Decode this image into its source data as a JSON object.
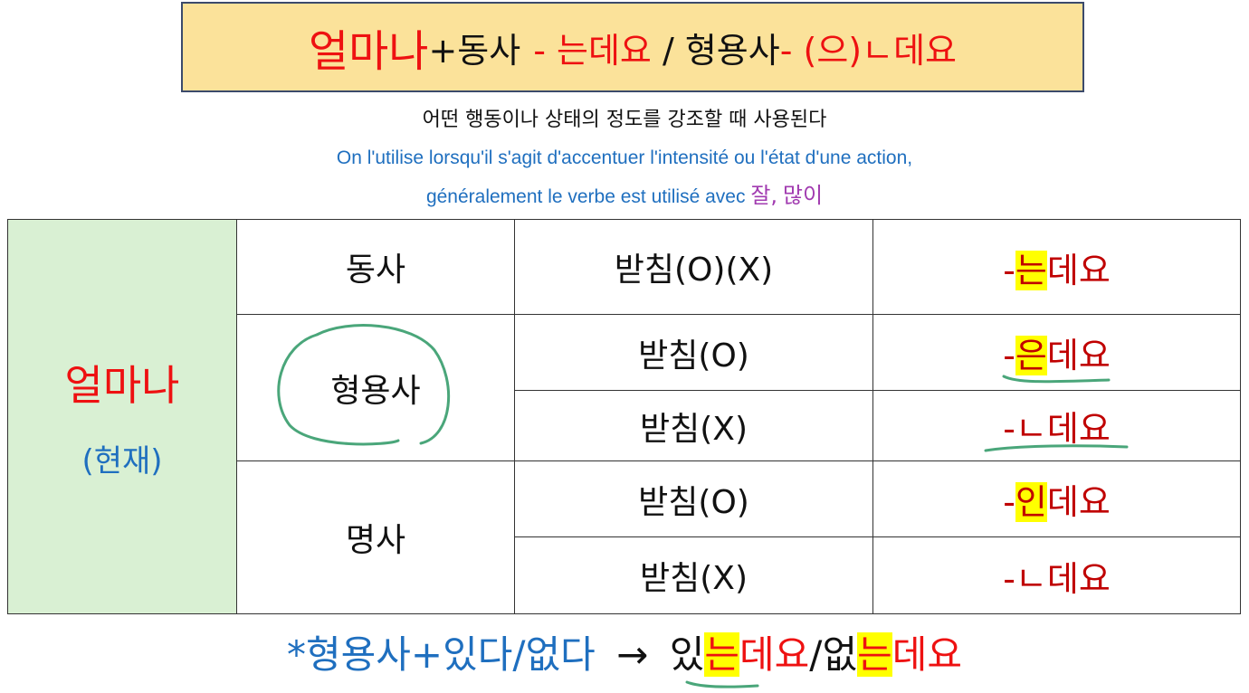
{
  "title": {
    "part1": "얼마나",
    "part2": "+동사",
    "part3": "- 는데요",
    "part4": " / 형용사",
    "part5": "- (으)ㄴ데요"
  },
  "subtitle_ko": "어떤 행동이나 상태의 정도를 강조할 때 사용된다",
  "subtitle_fr": {
    "line1": "On l'utilise lorsqu'il s'agit d'accentuer l'intensité ou l'état d'une action,",
    "line2": "généralement le verbe est utilisé avec",
    "word1": "잘",
    "comma": ",",
    "word2": "많이"
  },
  "table": {
    "left_main": "얼마나",
    "left_sub": "(현재)",
    "pos_verb": "동사",
    "pos_adj": "형용사",
    "pos_noun": "명사",
    "rows": [
      {
        "batchim": "받침(O)(X)",
        "prefix": "-",
        "highlight": "는",
        "suffix": "데요"
      },
      {
        "batchim": "받침(O)",
        "prefix": "-",
        "highlight": "은",
        "suffix": "데요"
      },
      {
        "batchim": "받침(X)",
        "prefix": "-ㄴ",
        "highlight": "",
        "suffix": "데요"
      },
      {
        "batchim": "받침(O)",
        "prefix": "-",
        "highlight": "인",
        "suffix": "데요"
      },
      {
        "batchim": "받침(X)",
        "prefix": "-ㄴ",
        "highlight": "",
        "suffix": "데요"
      }
    ]
  },
  "bottom": {
    "blue": "*형용사+있다/없다",
    "arrow": "→",
    "w1a": "있",
    "w1b": "는",
    "w1c": "데요",
    "slash": "/",
    "w2a": "없",
    "w2b": "는",
    "w2c": "데요"
  },
  "colors": {
    "red": "#ee1111",
    "blue": "#1f6fbf",
    "purple": "#a13bb0",
    "title_bg": "#fbe29a",
    "left_bg": "#d9f0d3",
    "highlight": "#ffff00",
    "annotation_green": "#4aa67a"
  }
}
